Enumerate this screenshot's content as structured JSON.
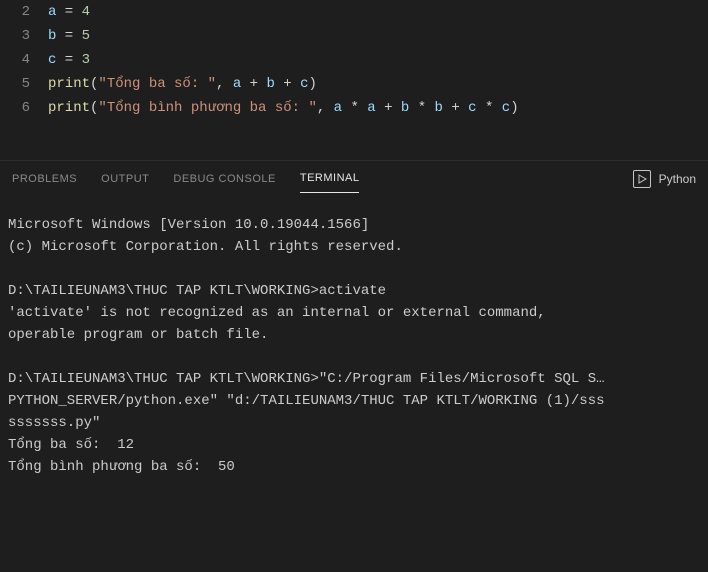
{
  "editor": {
    "lines": [
      {
        "num": "2",
        "tokens": [
          {
            "t": "var",
            "v": "a"
          },
          {
            "t": "op",
            "v": " = "
          },
          {
            "t": "num",
            "v": "4"
          }
        ]
      },
      {
        "num": "3",
        "tokens": [
          {
            "t": "var",
            "v": "b"
          },
          {
            "t": "op",
            "v": " = "
          },
          {
            "t": "num",
            "v": "5"
          }
        ]
      },
      {
        "num": "4",
        "tokens": [
          {
            "t": "var",
            "v": "c"
          },
          {
            "t": "op",
            "v": " = "
          },
          {
            "t": "num",
            "v": "3"
          }
        ]
      },
      {
        "num": "5",
        "tokens": [
          {
            "t": "fn",
            "v": "print"
          },
          {
            "t": "pn",
            "v": "("
          },
          {
            "t": "str",
            "v": "\"Tổng ba số: \""
          },
          {
            "t": "pn",
            "v": ", "
          },
          {
            "t": "var",
            "v": "a"
          },
          {
            "t": "op",
            "v": " + "
          },
          {
            "t": "var",
            "v": "b"
          },
          {
            "t": "op",
            "v": " + "
          },
          {
            "t": "var",
            "v": "c"
          },
          {
            "t": "pn",
            "v": ")"
          }
        ]
      },
      {
        "num": "6",
        "tokens": [
          {
            "t": "fn",
            "v": "print"
          },
          {
            "t": "pn",
            "v": "("
          },
          {
            "t": "str",
            "v": "\"Tổng bình phương ba số: \""
          },
          {
            "t": "pn",
            "v": ", "
          },
          {
            "t": "var",
            "v": "a"
          },
          {
            "t": "op",
            "v": " * "
          },
          {
            "t": "var",
            "v": "a"
          },
          {
            "t": "op",
            "v": " + "
          },
          {
            "t": "var",
            "v": "b"
          },
          {
            "t": "op",
            "v": " * "
          },
          {
            "t": "var",
            "v": "b"
          },
          {
            "t": "op",
            "v": " + "
          },
          {
            "t": "var",
            "v": "c"
          },
          {
            "t": "op",
            "v": " * "
          },
          {
            "t": "var",
            "v": "c"
          },
          {
            "t": "pn",
            "v": ")"
          }
        ]
      }
    ]
  },
  "panel": {
    "tabs": {
      "problems": "PROBLEMS",
      "output": "OUTPUT",
      "debug": "DEBUG CONSOLE",
      "terminal": "TERMINAL"
    },
    "active_tab": "terminal",
    "launch_label": "Python"
  },
  "terminal": {
    "blocks": [
      "Microsoft Windows [Version 10.0.19044.1566]\n(c) Microsoft Corporation. All rights reserved.",
      "D:\\TAILIEUNAM3\\THUC TAP KTLT\\WORKING>activate\n'activate' is not recognized as an internal or external command,\noperable program or batch file.",
      "D:\\TAILIEUNAM3\\THUC TAP KTLT\\WORKING>\"C:/Program Files/Microsoft SQL S…\nPYTHON_SERVER/python.exe\" \"d:/TAILIEUNAM3/THUC TAP KTLT/WORKING (1)/sss\nsssssss.py\"\nTổng ba số:  12\nTổng bình phương ba số:  50"
    ]
  }
}
